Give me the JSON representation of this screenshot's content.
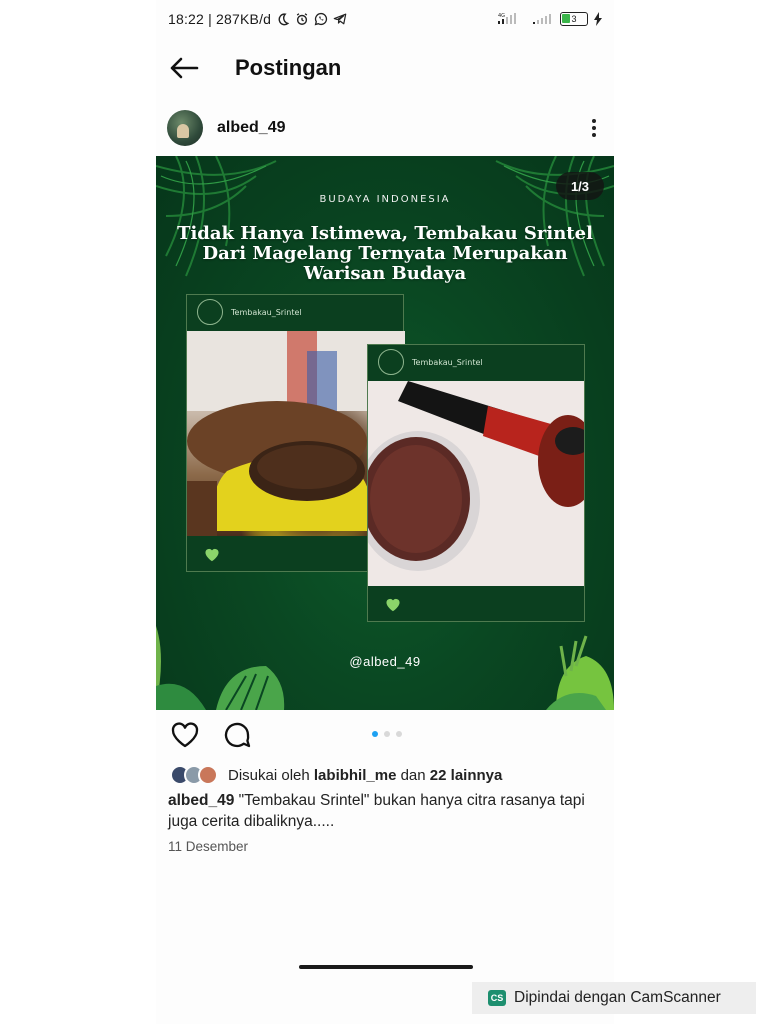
{
  "status_bar": {
    "time_speed": "18:22 | 287KB/d",
    "network": "4G",
    "battery": "3"
  },
  "header": {
    "title": "Postingan"
  },
  "post": {
    "username": "albed_49",
    "image": {
      "counter": "1/3",
      "kicker": "BUDAYA INDONESIA",
      "headline": "Tidak Hanya Istimewa, Tembakau Srintel Dari Magelang Ternyata Merupakan Warisan Budaya",
      "card1_user": "Tembakau_Srintel",
      "card2_user": "Tembakau_Srintel",
      "watermark": "@albed_49"
    },
    "carousel": {
      "total": 3,
      "active": 1
    },
    "likes": {
      "prefix": "Disukai oleh",
      "user": "labibhil_me",
      "joiner": "dan",
      "others": "22 lainnya"
    },
    "caption": {
      "user": "albed_49",
      "text": "\"Tembakau Srintel\" bukan hanya citra rasanya tapi juga cerita dibaliknya....."
    },
    "date": "11 Desember"
  },
  "camscanner": {
    "logo": "CS",
    "text": "Dipindai dengan CamScanner"
  },
  "colors": {
    "accent": "#1da1f2",
    "post_bg": "#0a4722",
    "heart_green": "#8bd46a",
    "camscanner": "#1d8f6f"
  },
  "icons": [
    "back-arrow-icon",
    "more-vertical-icon",
    "heart-icon",
    "comment-icon",
    "moon-icon",
    "alarm-icon",
    "whatsapp-icon",
    "telegram-icon",
    "signal-icon",
    "battery-icon",
    "charging-icon"
  ]
}
